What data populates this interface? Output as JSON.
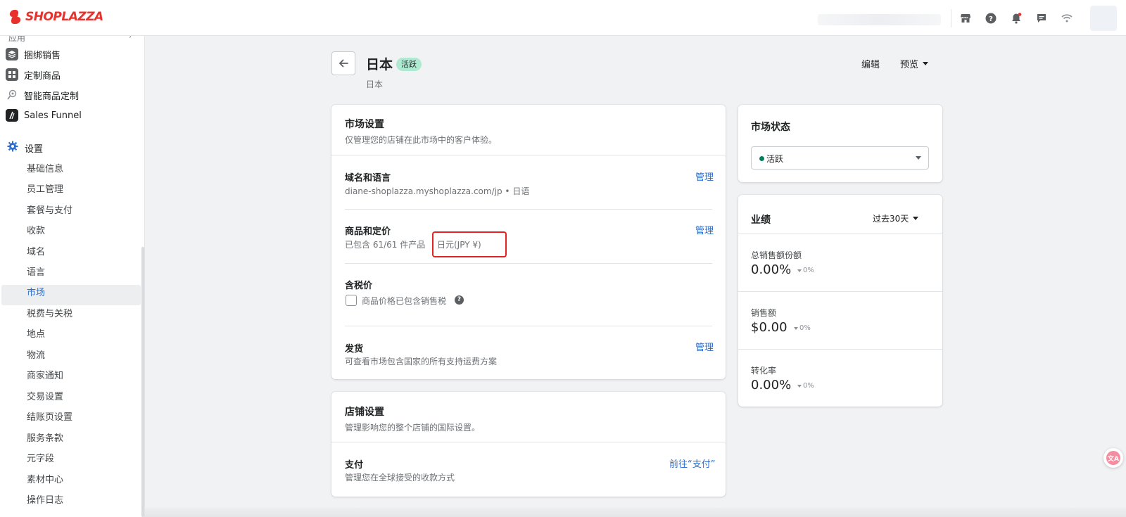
{
  "brand": {
    "name": "SHOPLAZZA",
    "color": "#e8302c"
  },
  "topbar": {
    "icons": [
      "store-icon",
      "help-icon",
      "bell-icon",
      "chat-icon",
      "wifi-icon"
    ]
  },
  "sidebar": {
    "cut_label": "应用",
    "apps": [
      {
        "label": "捆绑销售",
        "icon": "bundle-icon"
      },
      {
        "label": "定制商品",
        "icon": "custom-product-icon"
      },
      {
        "label": "智能商品定制",
        "icon": "smart-custom-icon"
      },
      {
        "label": "Sales Funnel",
        "icon": "funnel-icon"
      }
    ],
    "settings_label": "设置",
    "sub_items": [
      "基础信息",
      "员工管理",
      "套餐与支付",
      "收款",
      "域名",
      "语言",
      "市场",
      "税费与关税",
      "地点",
      "物流",
      "商家通知",
      "交易设置",
      "结账页设置",
      "服务条款",
      "元字段",
      "素材中心",
      "操作日志"
    ],
    "active_item": "市场"
  },
  "header": {
    "title": "日本",
    "status": "活跃",
    "subtitle": "日本",
    "edit_label": "编辑",
    "preview_label": "预览"
  },
  "market_settings": {
    "title": "市场设置",
    "description": "仅管理您的店铺在此市场中的客户体验。",
    "domain": {
      "title": "域名和语言",
      "url": "diane-shoplazza.myshoplazza.com/jp",
      "language": "日语",
      "separator": "•",
      "action": "管理"
    },
    "products": {
      "title": "商品和定价",
      "included": "已包含 61/61 件产品",
      "currency": "日元(JPY ¥)",
      "action": "管理"
    },
    "tax": {
      "title": "含税价",
      "checkbox_label": "商品价格已包含销售税",
      "checked": false
    },
    "shipping": {
      "title": "发货",
      "description": "可查看市场包含国家的所有支持运费方案",
      "action": "管理"
    }
  },
  "store_settings": {
    "title": "店铺设置",
    "description": "管理影响您的整个店铺的国际设置。",
    "payment": {
      "title": "支付",
      "description": "管理您在全球接受的收款方式",
      "action": "前往“支付”"
    }
  },
  "market_status": {
    "title": "市场状态",
    "selected": "活跃"
  },
  "performance": {
    "title": "业绩",
    "period": "过去30天",
    "metrics": [
      {
        "label": "总销售额份额",
        "value": "0.00%",
        "delta": "0%"
      },
      {
        "label": "销售额",
        "value": "$0.00",
        "delta": "0%"
      },
      {
        "label": "转化率",
        "value": "0.00%",
        "delta": "0%"
      }
    ]
  },
  "translate_button": {
    "label": "文A"
  }
}
